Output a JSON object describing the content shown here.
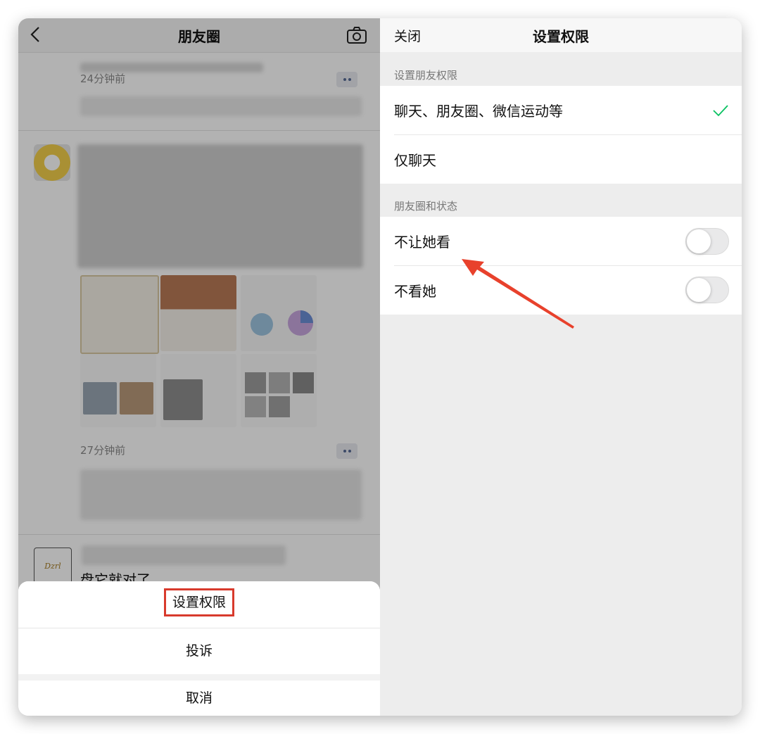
{
  "left": {
    "nav": {
      "title": "朋友圈",
      "back_icon": "chevron-left-icon",
      "camera_icon": "camera-icon"
    },
    "posts": [
      {
        "timestamp": "24分钟前"
      },
      {
        "timestamp": "27分钟前"
      },
      {
        "text": "盘它就对了"
      }
    ],
    "action_sheet": {
      "items": [
        "设置权限",
        "投诉"
      ],
      "cancel": "取消",
      "highlight_color": "#d83a2c"
    }
  },
  "right": {
    "nav": {
      "close_label": "关闭",
      "title": "设置权限"
    },
    "friend_permission": {
      "section_label": "设置朋友权限",
      "options": [
        {
          "label": "聊天、朋友圈、微信运动等",
          "selected": true
        },
        {
          "label": "仅聊天",
          "selected": false
        }
      ]
    },
    "moments_status": {
      "section_label": "朋友圈和状态",
      "toggles": [
        {
          "label": "不让她看",
          "on": false
        },
        {
          "label": "不看她",
          "on": false
        }
      ]
    },
    "accent_color": "#07c160",
    "annotation_arrow_color": "#e8412c"
  }
}
